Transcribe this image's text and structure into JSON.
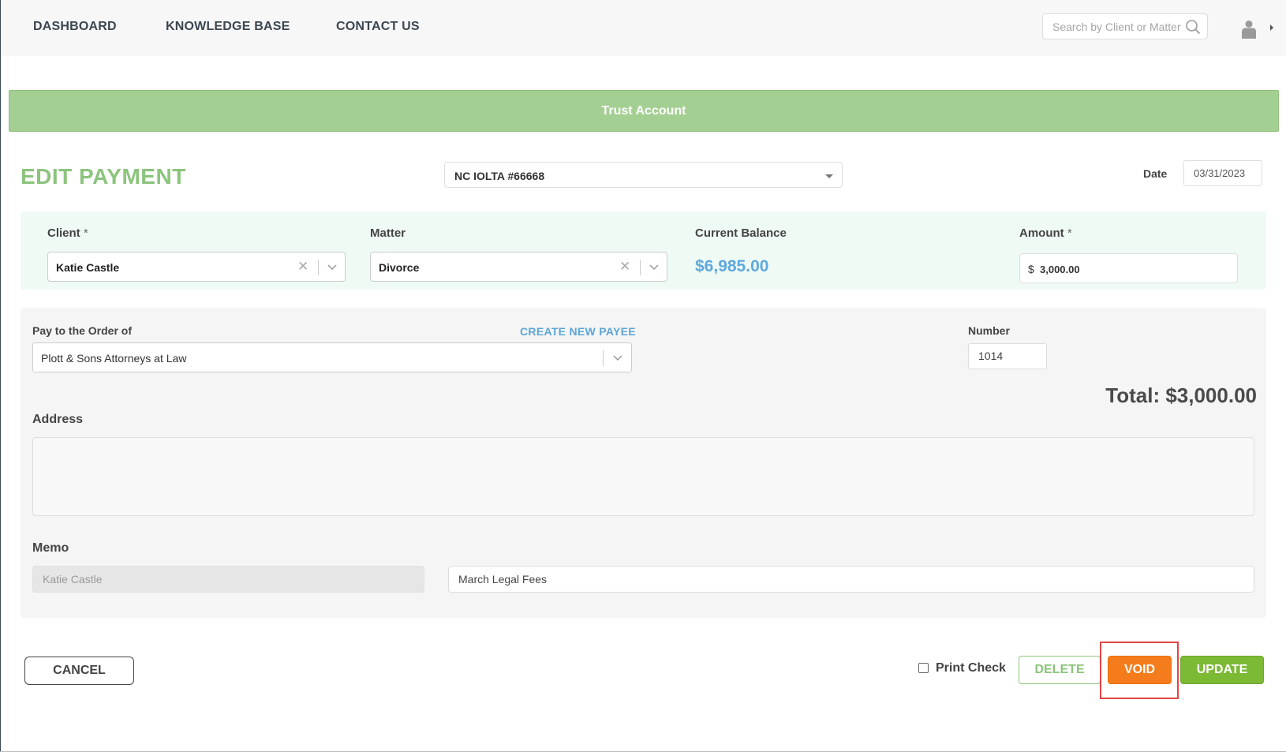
{
  "nav": {
    "items": [
      "DASHBOARD",
      "KNOWLEDGE BASE",
      "CONTACT US"
    ],
    "search_placeholder": "Search by Client or Matter",
    "icons": {
      "search": "search-icon",
      "user": "user-icon",
      "menu": "caret-right-icon"
    }
  },
  "banner": {
    "title": "Trust Account"
  },
  "page": {
    "title": "EDIT PAYMENT",
    "account": "NC IOLTA #66668",
    "date_label": "Date",
    "date_value": "03/31/2023"
  },
  "client_section": {
    "client_label": "Client",
    "client_value": "Katie Castle",
    "matter_label": "Matter",
    "matter_value": "Divorce",
    "balance_label": "Current Balance",
    "balance_value": "$6,985.00",
    "amount_label": "Amount",
    "amount_currency": "$",
    "amount_value": "3,000.00",
    "required_mark": "*"
  },
  "payee_section": {
    "pay_to_label": "Pay to the Order of",
    "create_payee_link": "CREATE NEW PAYEE",
    "payee_value": "Plott & Sons Attorneys at Law",
    "number_label": "Number",
    "number_value": "1014",
    "total": "Total: $3,000.00",
    "address_label": "Address",
    "address_value": "",
    "memo_label": "Memo",
    "memo_client": "Katie Castle",
    "memo_value": "March Legal Fees"
  },
  "actions": {
    "cancel": "CANCEL",
    "print_check": "Print Check",
    "print_check_checked": false,
    "delete": "DELETE",
    "void": "VOID",
    "update": "UPDATE"
  },
  "colors": {
    "accent_green": "#8cc47d",
    "banner_green": "#a4cf92",
    "balance_blue": "#5fa8dc",
    "void_orange": "#f47c1c",
    "update_green": "#7cb935",
    "highlight_red": "#e04646"
  }
}
